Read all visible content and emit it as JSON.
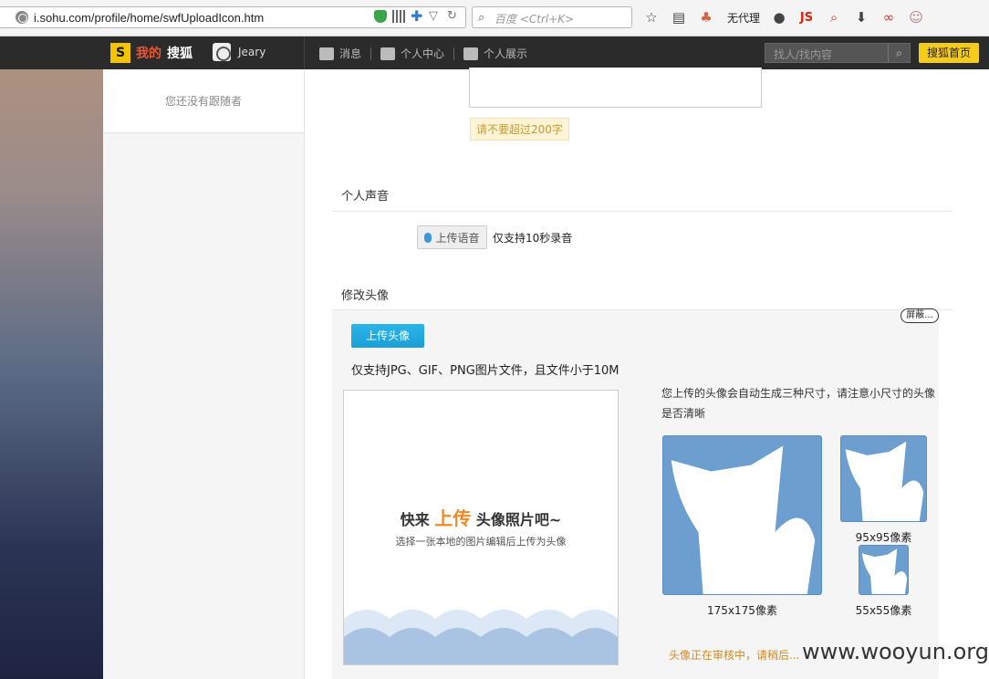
{
  "browser": {
    "url": "i.sohu.com/profile/home/swfUploadIcon.htm",
    "search_placeholder": "百度 <Ctrl+K>",
    "proxy_label": "无代理",
    "js_label": "JS"
  },
  "sitenav": {
    "brand_my": "我的",
    "brand_sohu": "搜狐",
    "username": "Jeary",
    "links": [
      "消息",
      "个人中心",
      "个人展示"
    ],
    "search_placeholder": "找人/找内容",
    "home_button": "搜狐首页"
  },
  "sidebar": {
    "followers_text": "您还没有跟随者"
  },
  "main": {
    "char_limit": "请不要超过200字",
    "voice_section": {
      "title": "个人声音",
      "upload_label": "上传语音",
      "tip": "仅支持10秒录音"
    },
    "avatar_section": {
      "title": "修改头像",
      "shield_tag": "屏蔽...",
      "upload_button": "上传头像",
      "format_tip": "仅支持JPG、GIF、PNG图片文件，且文件小于10M",
      "dropzone_before": "快来",
      "dropzone_highlight": "上传",
      "dropzone_after": "头像照片吧~",
      "dropzone_sub": "选择一张本地的图片编辑后上传为头像",
      "note": "您上传的头像会自动生成三种尺寸，请注意小尺寸的头像是否清晰",
      "sizes": [
        "175x175像素",
        "95x95像素",
        "55x55像素"
      ],
      "review_notice": "头像正在审核中，请稍后..."
    }
  },
  "watermark": "www.wooyun.org"
}
